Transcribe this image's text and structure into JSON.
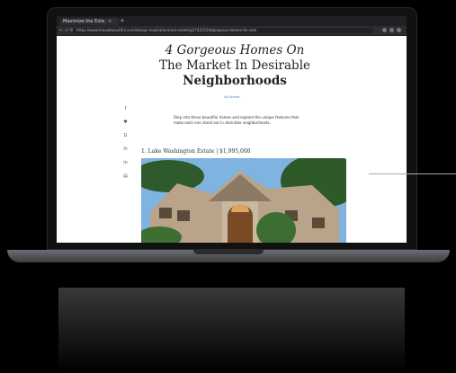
{
  "browser": {
    "tab_title": "Maximize the Exte...",
    "tab_close": "×",
    "new_tab": "+",
    "nav_icons": "← → ↻",
    "url": "https://www.housebeautiful.com/design-inspiration/real-estate/g27421534/gorgeous-homes-for-sale"
  },
  "article": {
    "headline_line1": "4 Gorgeous Homes On",
    "headline_line2": "The Market In Desirable",
    "headline_line3": "Neighborhoods",
    "author": "By Author",
    "intro": "Step into these beautiful homes and explore the unique features that make each one stand out in desirable neighborhoods.",
    "section_title": "1. Lake Washington Estate | $1,995,000"
  },
  "share_icons": [
    "f",
    "♥",
    "G",
    "✉",
    "in",
    "▤"
  ]
}
